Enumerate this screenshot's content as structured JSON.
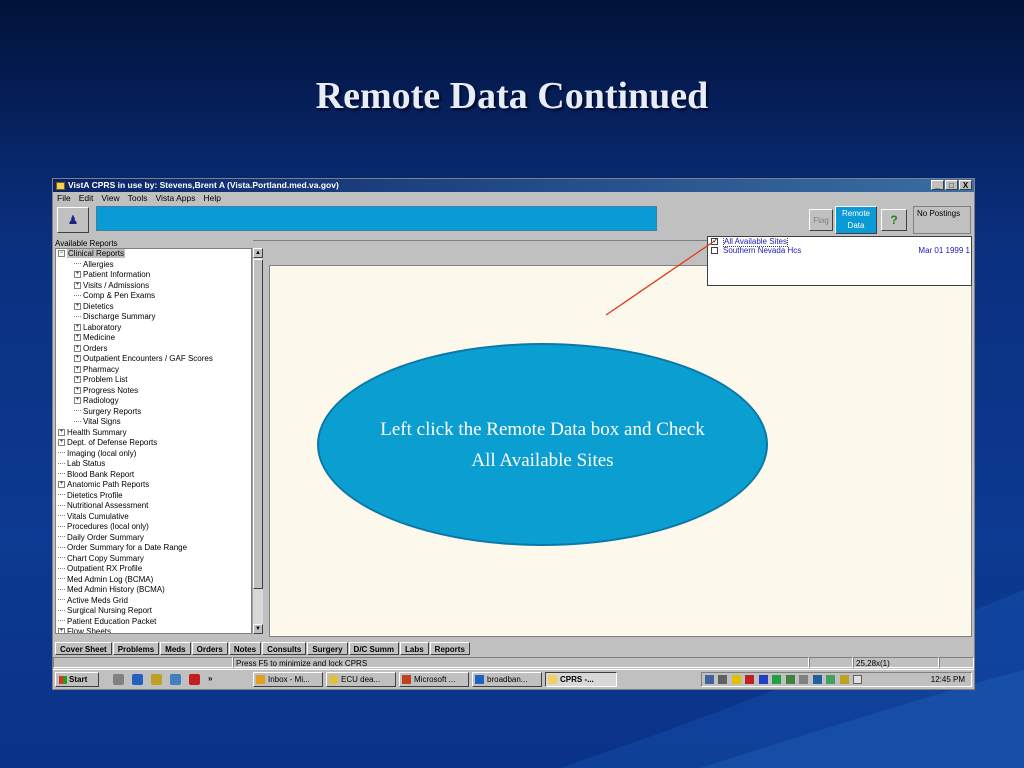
{
  "slide": {
    "title": "Remote Data Continued"
  },
  "window": {
    "title": "VistA CPRS in use by: Stevens,Brent A  (Vista.Portland.med.va.gov)",
    "controls": [
      "_",
      "□",
      "X"
    ]
  },
  "menu": [
    "File",
    "Edit",
    "View",
    "Tools",
    "Vista Apps",
    "Help"
  ],
  "toolbar": {
    "flag_label": "Flag",
    "remote_label_1": "Remote",
    "remote_label_2": "Data",
    "help_label": "?",
    "postings_label": "No Postings"
  },
  "reports": {
    "heading": "Available Reports",
    "tree": [
      {
        "label": "Clinical Reports",
        "indent": 0,
        "type": "expanded",
        "selected": true
      },
      {
        "label": "Allergies",
        "indent": 1,
        "type": "leaf"
      },
      {
        "label": "Patient Information",
        "indent": 1,
        "type": "collapsed"
      },
      {
        "label": "Visits / Admissions",
        "indent": 1,
        "type": "collapsed"
      },
      {
        "label": "Comp & Pen Exams",
        "indent": 1,
        "type": "leaf"
      },
      {
        "label": "Dietetics",
        "indent": 1,
        "type": "collapsed"
      },
      {
        "label": "Discharge Summary",
        "indent": 1,
        "type": "leaf"
      },
      {
        "label": "Laboratory",
        "indent": 1,
        "type": "collapsed"
      },
      {
        "label": "Medicine",
        "indent": 1,
        "type": "collapsed"
      },
      {
        "label": "Orders",
        "indent": 1,
        "type": "collapsed"
      },
      {
        "label": "Outpatient Encounters / GAF Scores",
        "indent": 1,
        "type": "collapsed"
      },
      {
        "label": "Pharmacy",
        "indent": 1,
        "type": "collapsed"
      },
      {
        "label": "Problem List",
        "indent": 1,
        "type": "collapsed"
      },
      {
        "label": "Progress Notes",
        "indent": 1,
        "type": "collapsed"
      },
      {
        "label": "Radiology",
        "indent": 1,
        "type": "collapsed"
      },
      {
        "label": "Surgery Reports",
        "indent": 1,
        "type": "leaf"
      },
      {
        "label": "Vital Signs",
        "indent": 1,
        "type": "leaf"
      },
      {
        "label": "Health Summary",
        "indent": 0,
        "type": "collapsed"
      },
      {
        "label": "Dept. of Defense Reports",
        "indent": 0,
        "type": "collapsed"
      },
      {
        "label": "Imaging (local only)",
        "indent": 0,
        "type": "leaf"
      },
      {
        "label": "Lab Status",
        "indent": 0,
        "type": "leaf"
      },
      {
        "label": "Blood Bank Report",
        "indent": 0,
        "type": "leaf"
      },
      {
        "label": "Anatomic Path Reports",
        "indent": 0,
        "type": "collapsed"
      },
      {
        "label": "Dietetics Profile",
        "indent": 0,
        "type": "leaf"
      },
      {
        "label": "Nutritional Assessment",
        "indent": 0,
        "type": "leaf"
      },
      {
        "label": "Vitals Cumulative",
        "indent": 0,
        "type": "leaf"
      },
      {
        "label": "Procedures (local only)",
        "indent": 0,
        "type": "leaf"
      },
      {
        "label": "Daily Order Summary",
        "indent": 0,
        "type": "leaf"
      },
      {
        "label": "Order Summary for a Date Range",
        "indent": 0,
        "type": "leaf"
      },
      {
        "label": "Chart Copy Summary",
        "indent": 0,
        "type": "leaf"
      },
      {
        "label": "Outpatient RX Profile",
        "indent": 0,
        "type": "leaf"
      },
      {
        "label": "Med Admin Log (BCMA)",
        "indent": 0,
        "type": "leaf"
      },
      {
        "label": "Med Admin History (BCMA)",
        "indent": 0,
        "type": "leaf"
      },
      {
        "label": "Active Meds Grid",
        "indent": 0,
        "type": "leaf"
      },
      {
        "label": "Surgical Nursing Report",
        "indent": 0,
        "type": "leaf"
      },
      {
        "label": "Patient Education Packet",
        "indent": 0,
        "type": "leaf"
      },
      {
        "label": "Flow Sheets",
        "indent": 0,
        "type": "collapsed"
      }
    ]
  },
  "remote_sites": [
    {
      "label": "All Available Sites",
      "date": "",
      "checked": true
    },
    {
      "label": "Southern Nevada Hcs",
      "date": "Mar 01 1999 1",
      "checked": false
    }
  ],
  "tabs": [
    "Cover Sheet",
    "Problems",
    "Meds",
    "Orders",
    "Notes",
    "Consults",
    "Surgery",
    "D/C Summ",
    "Labs",
    "Reports"
  ],
  "active_tab": "Reports",
  "status": {
    "message": "Press F5 to minimize and lock CPRS",
    "position": "25,28x(1)"
  },
  "taskbar": {
    "start_label": "Start",
    "chevron": "»",
    "tasks": [
      "Inbox - Mi...",
      "ECU dea...",
      "Microsoft ...",
      "broadban...",
      "CPRS -..."
    ],
    "clock": "12:45 PM"
  },
  "callout": {
    "line1": "Left click the Remote Data box and Check",
    "line2": "All Available Sites"
  },
  "colors": {
    "accent": "#0a9ad6",
    "arrow": "#e03a1a",
    "link": "#1a1ab4"
  }
}
